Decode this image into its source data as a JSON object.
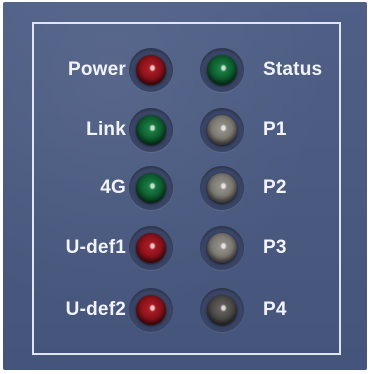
{
  "panel": {
    "rows": [
      {
        "left_label": "Power",
        "left_led": "red",
        "right_led": "green",
        "right_label": "Status"
      },
      {
        "left_label": "Link",
        "left_led": "green",
        "right_led": "off",
        "right_label": "P1"
      },
      {
        "left_label": "4G",
        "left_led": "green",
        "right_led": "off",
        "right_label": "P2"
      },
      {
        "left_label": "U-def1",
        "left_led": "red",
        "right_led": "off",
        "right_label": "P3"
      },
      {
        "left_label": "U-def2",
        "left_led": "red",
        "right_led": "dark",
        "right_label": "P4"
      }
    ]
  },
  "colors": {
    "plate": "#4a5a80",
    "label": "#f1f3f8",
    "frame": "#dfe5f1"
  }
}
